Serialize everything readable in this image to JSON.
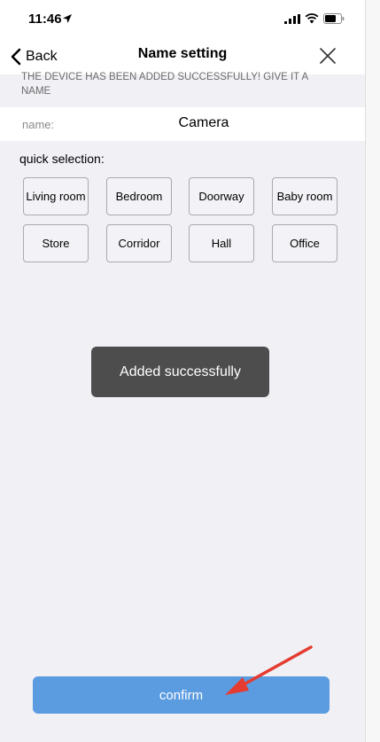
{
  "status_bar": {
    "time": "11:46",
    "icons": [
      "location-arrow-icon",
      "signal-icon",
      "wifi-icon",
      "battery-icon"
    ]
  },
  "nav": {
    "back_label": "Back",
    "title": "Name setting",
    "close_icon": "close-icon"
  },
  "notice": "THE DEVICE HAS BEEN ADDED SUCCESSFULLY! GIVE IT A NAME",
  "name_field": {
    "label": "name:",
    "value": "Camera"
  },
  "quick_selection": {
    "label": "quick selection:",
    "options": [
      "Living room",
      "Bedroom",
      "Doorway",
      "Baby room",
      "Store",
      "Corridor",
      "Hall",
      "Office"
    ]
  },
  "toast": "Added successfully",
  "confirm_label": "confirm",
  "colors": {
    "background": "#f0f0f5",
    "confirm_button": "#5b9be0",
    "toast_background": "#4d4d4d",
    "annotation_arrow": "#e53b30"
  }
}
